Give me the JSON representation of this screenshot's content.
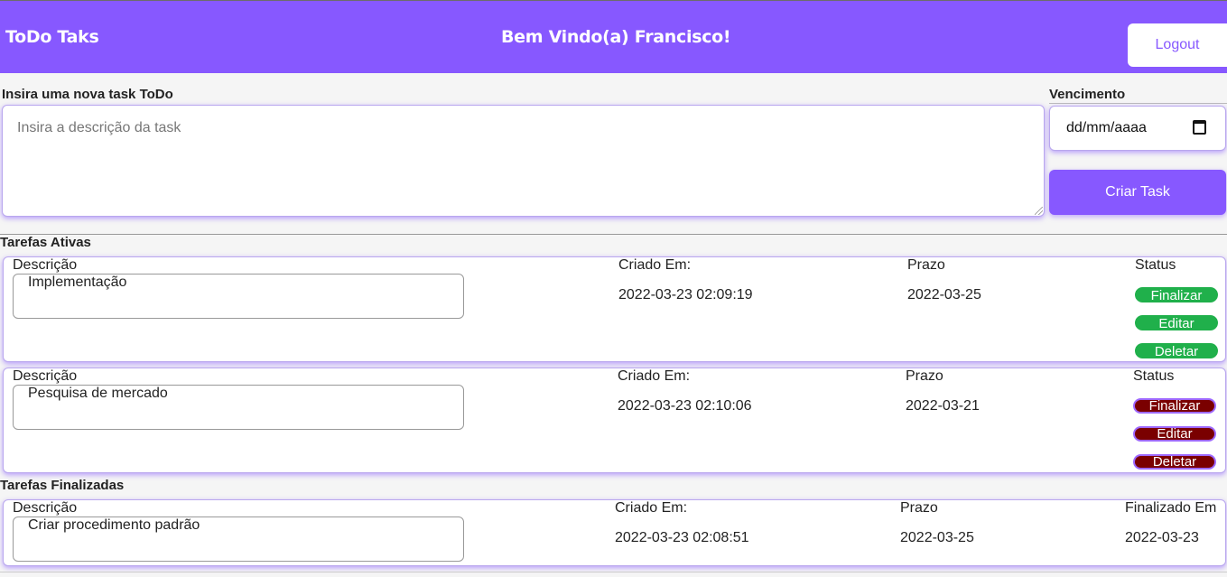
{
  "header": {
    "brand": "ToDo Taks",
    "welcome": "Bem Vindo(a) Francisco!",
    "logout_label": "Logout"
  },
  "form": {
    "new_task_label": "Insira uma nova task ToDo",
    "description_placeholder": "Insira a descrição da task",
    "due_label": "Vencimento",
    "date_placeholder": "dd/mm/aaaa",
    "create_label": "Criar Task"
  },
  "active": {
    "title": "Tarefas Ativas",
    "tasks": [
      {
        "desc_label": "Descrição",
        "description": "Implementação",
        "created_label": "Criado Em:",
        "created": "2022-03-23 02:09:19",
        "due_label": "Prazo",
        "due": "2022-03-25",
        "status_label": "Status",
        "finish_label": "Finalizar",
        "edit_label": "Editar",
        "delete_label": "Deletar",
        "status_color": "#20b04b"
      },
      {
        "desc_label": "Descrição",
        "description": "Pesquisa de mercado",
        "created_label": "Criado Em:",
        "created": "2022-03-23 02:10:06",
        "due_label": "Prazo",
        "due": "2022-03-21",
        "status_label": "Status",
        "finish_label": "Finalizar",
        "edit_label": "Editar",
        "delete_label": "Deletar",
        "status_color": "#7a0000"
      }
    ]
  },
  "finished": {
    "title": "Tarefas Finalizadas",
    "tasks": [
      {
        "desc_label": "Descrição",
        "description": "Criar procedimento padrão",
        "created_label": "Criado Em:",
        "created": "2022-03-23 02:08:51",
        "due_label": "Prazo",
        "due": "2022-03-25",
        "finished_label": "Finalizado Em",
        "finished": "2022-03-23"
      }
    ]
  },
  "colors": {
    "accent": "#8758ff",
    "ok": "#20b04b",
    "overdue": "#7a0000"
  }
}
